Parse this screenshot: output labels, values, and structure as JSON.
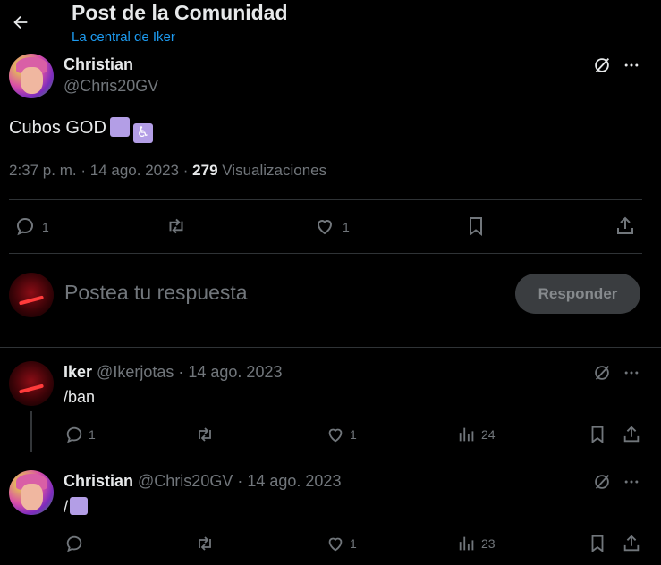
{
  "header": {
    "title": "Post de la Comunidad",
    "community": "La central de Iker"
  },
  "post": {
    "author_name": "Christian",
    "author_handle": "@Chris20GV",
    "text": "Cubos GOD",
    "time": "2:37 p. m.",
    "separator": "·",
    "date": "14 ago. 2023",
    "views_count": "279",
    "views_label": "Visualizaciones",
    "replies": "1",
    "likes": "1"
  },
  "composer": {
    "placeholder": "Postea tu respuesta",
    "reply_button": "Responder"
  },
  "replies": [
    {
      "name": "Iker",
      "handle": "@Ikerjotas",
      "date": "· 14 ago. 2023",
      "text": "/ban",
      "replies": "1",
      "likes": "1",
      "views": "24"
    },
    {
      "name": "Christian",
      "handle": "@Chris20GV",
      "date": "· 14 ago. 2023",
      "text": "/",
      "replies": "",
      "likes": "1",
      "views": "23"
    }
  ],
  "colors": {
    "background": "#000000",
    "accent": "#1d9bf0",
    "muted": "#71767b",
    "text": "#e7e9ea",
    "divider": "#2f3336"
  }
}
